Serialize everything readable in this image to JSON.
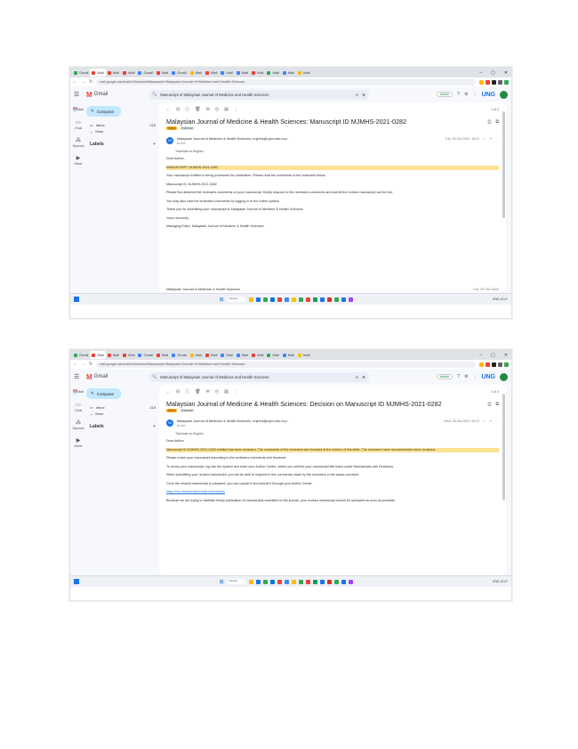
{
  "browser": {
    "tabs": [
      "Gmail",
      "Mail",
      "Mail",
      "Mail",
      "Gmail",
      "Mail",
      "Gmail",
      "Mail",
      "Mail",
      "Mail",
      "Mail",
      "Mail",
      "Mail",
      "Mail",
      "Mail"
    ],
    "tab_colors": [
      "#34a853",
      "#ea4335",
      "#ea4335",
      "#ea4335",
      "#4285f4",
      "#ea4335",
      "#4285f4",
      "#fbbc04",
      "#ea4335",
      "#4285f4",
      "#4285f4",
      "#ea4335",
      "#34a853",
      "#4285f4",
      "#fbbc04"
    ],
    "url": "mail.google.com/mail/u/0/#search/Manuscript+Malaysian+Journal+of+Medicine+and+Health+Sciences",
    "ext_colors": [
      "#fbbc04",
      "#ea4335",
      "#202124",
      "#5f6368",
      "#34a853"
    ]
  },
  "gmail": {
    "app_name": "Gmail",
    "search_query": "Manuscript of Malaysian Journal of Medicine and Health Sciences",
    "status": "Active",
    "brand": "UNG",
    "compose": "Compose",
    "inbox_label": "Inbox",
    "inbox_count": "215",
    "more_label": "More",
    "labels_title": "Labels",
    "rail": [
      "Mail",
      "Chat",
      "Spaces",
      "Meet"
    ],
    "pagination": "1 of 4"
  },
  "email1": {
    "subject": "Malaysian Journal of Medicine & Health Sciences: Manuscript ID MJMHS-2021-0282",
    "tag_inbox": "Inbox",
    "tag_ext": "External",
    "sender": "Malaysian Journal of Medicine & Health Sciences <mjmhs@upm.edu.my>",
    "to": "to me",
    "date": "Tue, 25 Oct 2022, 10:47",
    "translate": "Translate to English",
    "body": [
      "Dear Author,",
      "MANUSCRIPT: MJMHS-2021-0282",
      "Your manuscript entitled is being processed for publication. Please read the comments of the reviewers below.",
      "Manuscript ID: MJMHS-2021-0282",
      "Please find attached the reviewers comments on your manuscript. Kindly respond to the reviewers comments and submit the revised manuscript via the link.",
      "You may also view the reviewers comments by logging in to the online system.",
      "Thank you for submitting your manuscript to Malaysian Journal of Medicine & Health Sciences.",
      "Yours sincerely,",
      "Managing Editor, Malaysian Journal of Medicine & Health Sciences"
    ],
    "second_sender": "Malaysian Journal of Medicine & Health Sciences",
    "second_date": "Tue, 25 Oct 2022"
  },
  "email2": {
    "subject": "Malaysian Journal of Medicine & Health Sciences: Decision on Manuscript ID MJMHS-2021-0282",
    "tag_inbox": "Inbox",
    "tag_ext": "External",
    "sender": "Malaysian Journal of Medicine & Health Sciences <mjmhs@upm.edu.my>",
    "to": "to me",
    "date": "Wed, 26 Oct 2022, 09:12",
    "translate": "Translate to English",
    "body": [
      "Dear Author,",
      "Manuscript ID MJMHS-2021-0282 entitled has been reviewed. The comments of the reviewers are included at the bottom of this letter. The reviewers have recommended minor revisions.",
      "Please revise your manuscript according to the reviewers comments and resubmit.",
      "To revise your manuscript, log into the system and enter your Author Center, where you will find your manuscript title listed under Manuscripts with Decisions.",
      "When submitting your revised manuscript, you will be able to respond to the comments made by the reviewers in the space provided.",
      "Once the revised manuscript is prepared, you can upload it and submit it through your Author Center.",
      "https://mc.manuscriptcentral.com/mjmhs",
      "Because we are trying to facilitate timely publication of manuscripts submitted to the journal, your revised manuscript should be uploaded as soon as possible."
    ]
  },
  "taskbar": {
    "search": "Search",
    "app_colors": [
      "#fbbc04",
      "#1a73e8",
      "#34a853",
      "#0078d4",
      "#ea4335",
      "#4285f4",
      "#fbbc04",
      "#34a853",
      "#ea4335",
      "#0f9d58",
      "#1a73e8",
      "#d93025",
      "#34a853",
      "#1a73e8",
      "#a142f4"
    ],
    "tray": "ENG  10:47"
  }
}
